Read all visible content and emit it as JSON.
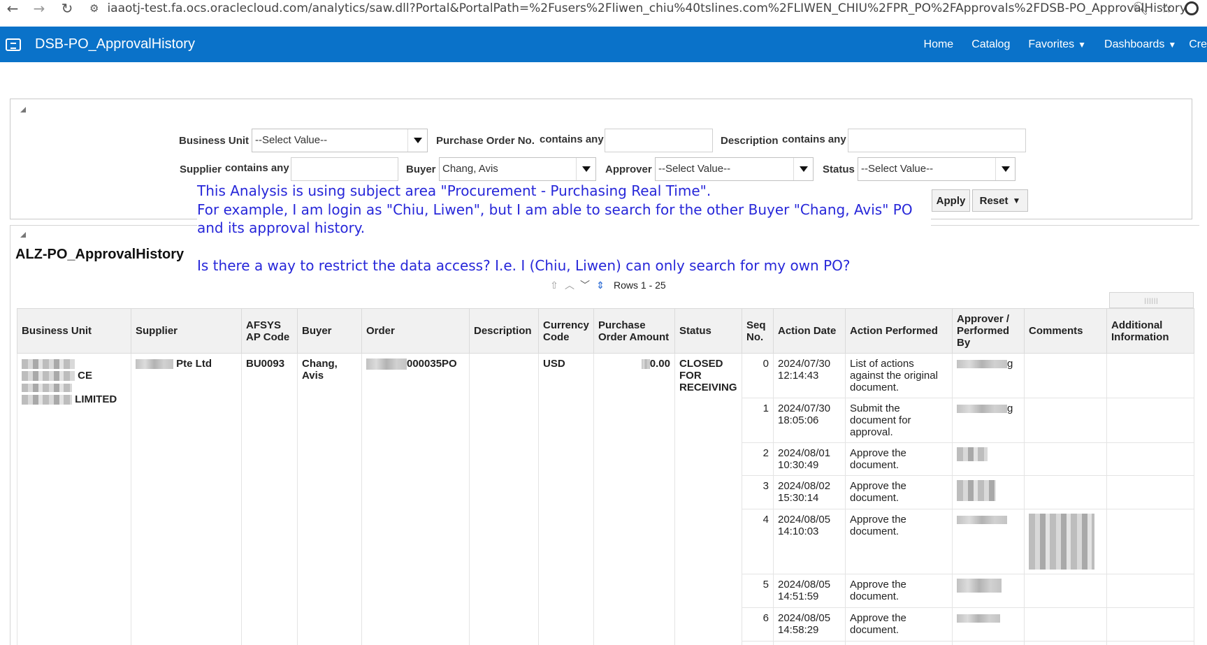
{
  "browser": {
    "url": "iaaotj-test.fa.ocs.oraclecloud.com/analytics/saw.dll?Portal&PortalPath=%2Fusers%2Fliwen_chiu%40tslines.com%2FLIWEN_CHIU%2FPR_PO%2FApprovals%2FDSB-PO_ApprovalHistory"
  },
  "header": {
    "title": "DSB-PO_ApprovalHistory",
    "nav": {
      "home": "Home",
      "catalog": "Catalog",
      "favorites": "Favorites",
      "dashboards": "Dashboards",
      "create": "Cre"
    }
  },
  "prompts": {
    "business_unit_label": "Business Unit",
    "business_unit_value": "--Select Value--",
    "po_no_label": "Purchase Order No.",
    "po_no_op": "contains any",
    "description_label": "Description",
    "description_op": "contains any",
    "supplier_label": "Supplier",
    "supplier_op": "contains any",
    "buyer_label": "Buyer",
    "buyer_value": "Chang, Avis",
    "approver_label": "Approver",
    "approver_value": "--Select Value--",
    "status_label": "Status",
    "status_value": "--Select Value--",
    "apply": "Apply",
    "reset": "Reset"
  },
  "note": {
    "line1": "This Analysis is using subject area \"Procurement - Purchasing Real Time\".",
    "line2": "For example, I am login as \"Chiu, Liwen\", but I am able to search for the other Buyer \"Chang, Avis\" PO",
    "line3": "and its approval history.",
    "line4": "Is there a way to restrict the data access? I.e. I (Chiu, Liwen) can only search for my own PO?"
  },
  "report": {
    "title": "ALZ-PO_ApprovalHistory",
    "rows_label": "Rows 1 - 25",
    "columns": [
      "Business Unit",
      "Supplier",
      "AFSYS AP Code",
      "Buyer",
      "Order",
      "Description",
      "Currency Code",
      "Purchase Order Amount",
      "Status",
      "Seq No.",
      "Action Date",
      "Action Performed",
      "Approver / Performed By",
      "Comments",
      "Additional Information"
    ],
    "group": {
      "bu_part1": "CE",
      "bu_part2": "LIMITED",
      "supplier": "Pte Ltd",
      "ap_code": "BU0093",
      "buyer": "Chang, Avis",
      "order": "000035PO",
      "currency": "USD",
      "amount": "0.00",
      "status": "CLOSED FOR RECEIVING"
    },
    "actions": [
      {
        "seq": "0",
        "date": "2024/07/30",
        "time": "12:14:43",
        "action": "List of actions against the original document.",
        "by_suffix": "g"
      },
      {
        "seq": "1",
        "date": "2024/07/30",
        "time": "18:05:06",
        "action": "Submit the document for approval.",
        "by_suffix": "g"
      },
      {
        "seq": "2",
        "date": "2024/08/01",
        "time": "10:30:49",
        "action": "Approve the document.",
        "by_suffix": ""
      },
      {
        "seq": "3",
        "date": "2024/08/02",
        "time": "15:30:14",
        "action": "Approve the document.",
        "by_suffix": ""
      },
      {
        "seq": "4",
        "date": "2024/08/05",
        "time": "14:10:03",
        "action": "Approve the document.",
        "by_suffix": ""
      },
      {
        "seq": "5",
        "date": "2024/08/05",
        "time": "14:51:59",
        "action": "Approve the document.",
        "by_suffix": ""
      },
      {
        "seq": "6",
        "date": "2024/08/05",
        "time": "14:58:29",
        "action": "Approve the document.",
        "by_suffix": ""
      }
    ]
  }
}
